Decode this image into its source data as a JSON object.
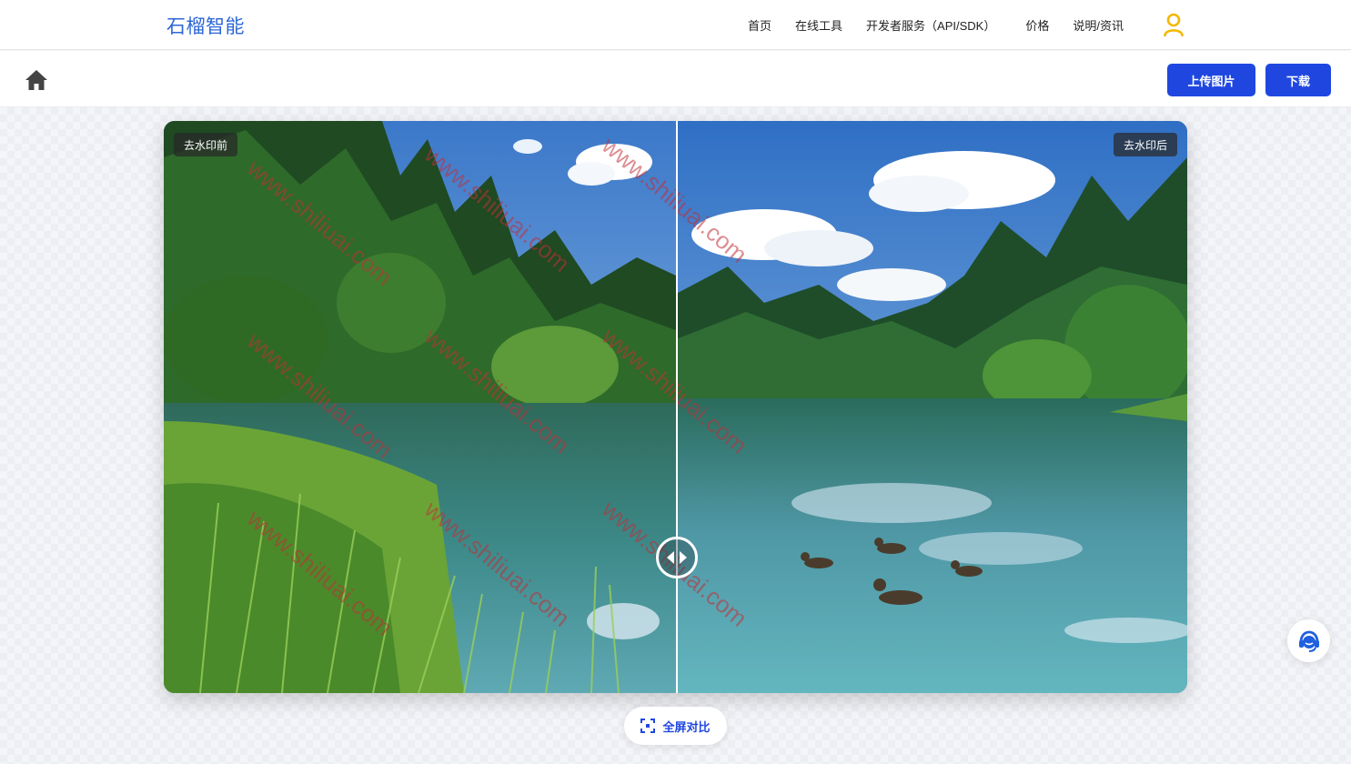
{
  "header": {
    "brand": "石榴智能",
    "nav": [
      "首页",
      "在线工具",
      "开发者服务（API/SDK）",
      "价格",
      "说明/资讯"
    ]
  },
  "toolbar": {
    "upload_label": "上传图片",
    "download_label": "下载"
  },
  "compare": {
    "before_label": "去水印前",
    "after_label": "去水印后",
    "watermark_text": "www.shiliuai.com"
  },
  "fullscreen_label": "全屏对比",
  "colors": {
    "brand": "#2b67d6",
    "primary_button": "#1f47e0",
    "user_icon": "#f5b800",
    "watermark": "#c0303a"
  }
}
